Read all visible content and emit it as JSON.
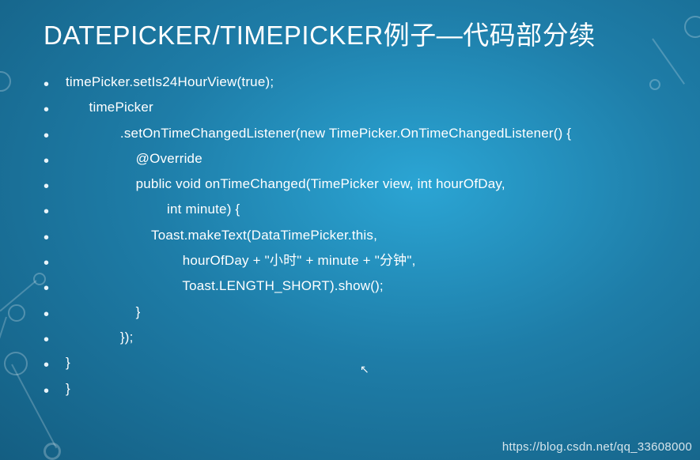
{
  "title": "DATEPICKER/TIMEPICKER例子—代码部分续",
  "code": {
    "lines": [
      "timePicker.setIs24HourView(true);",
      "      timePicker",
      "              .setOnTimeChangedListener(new TimePicker.OnTimeChangedListener() {",
      "                  @Override",
      "                  public void onTimeChanged(TimePicker view, int hourOfDay,",
      "                          int minute) {",
      "                      Toast.makeText(DataTimePicker.this,",
      "                              hourOfDay + \"小时\" + minute + \"分钟\",",
      "                              Toast.LENGTH_SHORT).show();",
      "                  }",
      "              });",
      "}",
      "}"
    ]
  },
  "watermark": "https://blog.csdn.net/qq_33608000"
}
